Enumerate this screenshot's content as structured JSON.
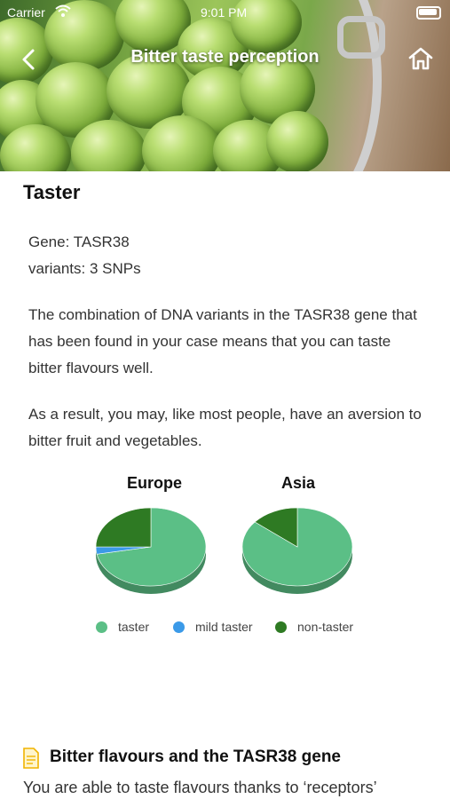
{
  "status_bar": {
    "carrier": "Carrier",
    "time": "9:01 PM"
  },
  "nav": {
    "title": "Bitter taste perception",
    "back_icon": "chevron-left-icon",
    "home_icon": "home-icon"
  },
  "result": {
    "heading": "Taster",
    "gene": "Gene: TASR38",
    "variants": "variants: 3 SNPs",
    "description": "The combination of DNA variants in the TASR38 gene that has been found in your case means that you can taste bitter flavours well.",
    "consequence": "As a result, you may, like most people, have an aversion to bitter fruit and vegetables."
  },
  "chart_data": [
    {
      "type": "pie",
      "title": "Europe",
      "labels": [
        "taster",
        "mild taster",
        "non-taster"
      ],
      "values": [
        0.72,
        0.03,
        0.25
      ],
      "colors": [
        "#5bbf86",
        "#3b9ae8",
        "#2e7a23"
      ]
    },
    {
      "type": "pie",
      "title": "Asia",
      "labels": [
        "taster",
        "mild taster",
        "non-taster"
      ],
      "values": [
        0.86,
        0.0,
        0.14
      ],
      "colors": [
        "#5bbf86",
        "#3b9ae8",
        "#2e7a23"
      ]
    }
  ],
  "legend": [
    {
      "label": "taster",
      "color": "#5bbf86"
    },
    {
      "label": "mild taster",
      "color": "#3b9ae8"
    },
    {
      "label": "non-taster",
      "color": "#2e7a23"
    }
  ],
  "section": {
    "icon": "document-icon",
    "title": "Bitter flavours and the TASR38 gene",
    "text": "You are able to taste flavours thanks to ‘receptors’"
  }
}
